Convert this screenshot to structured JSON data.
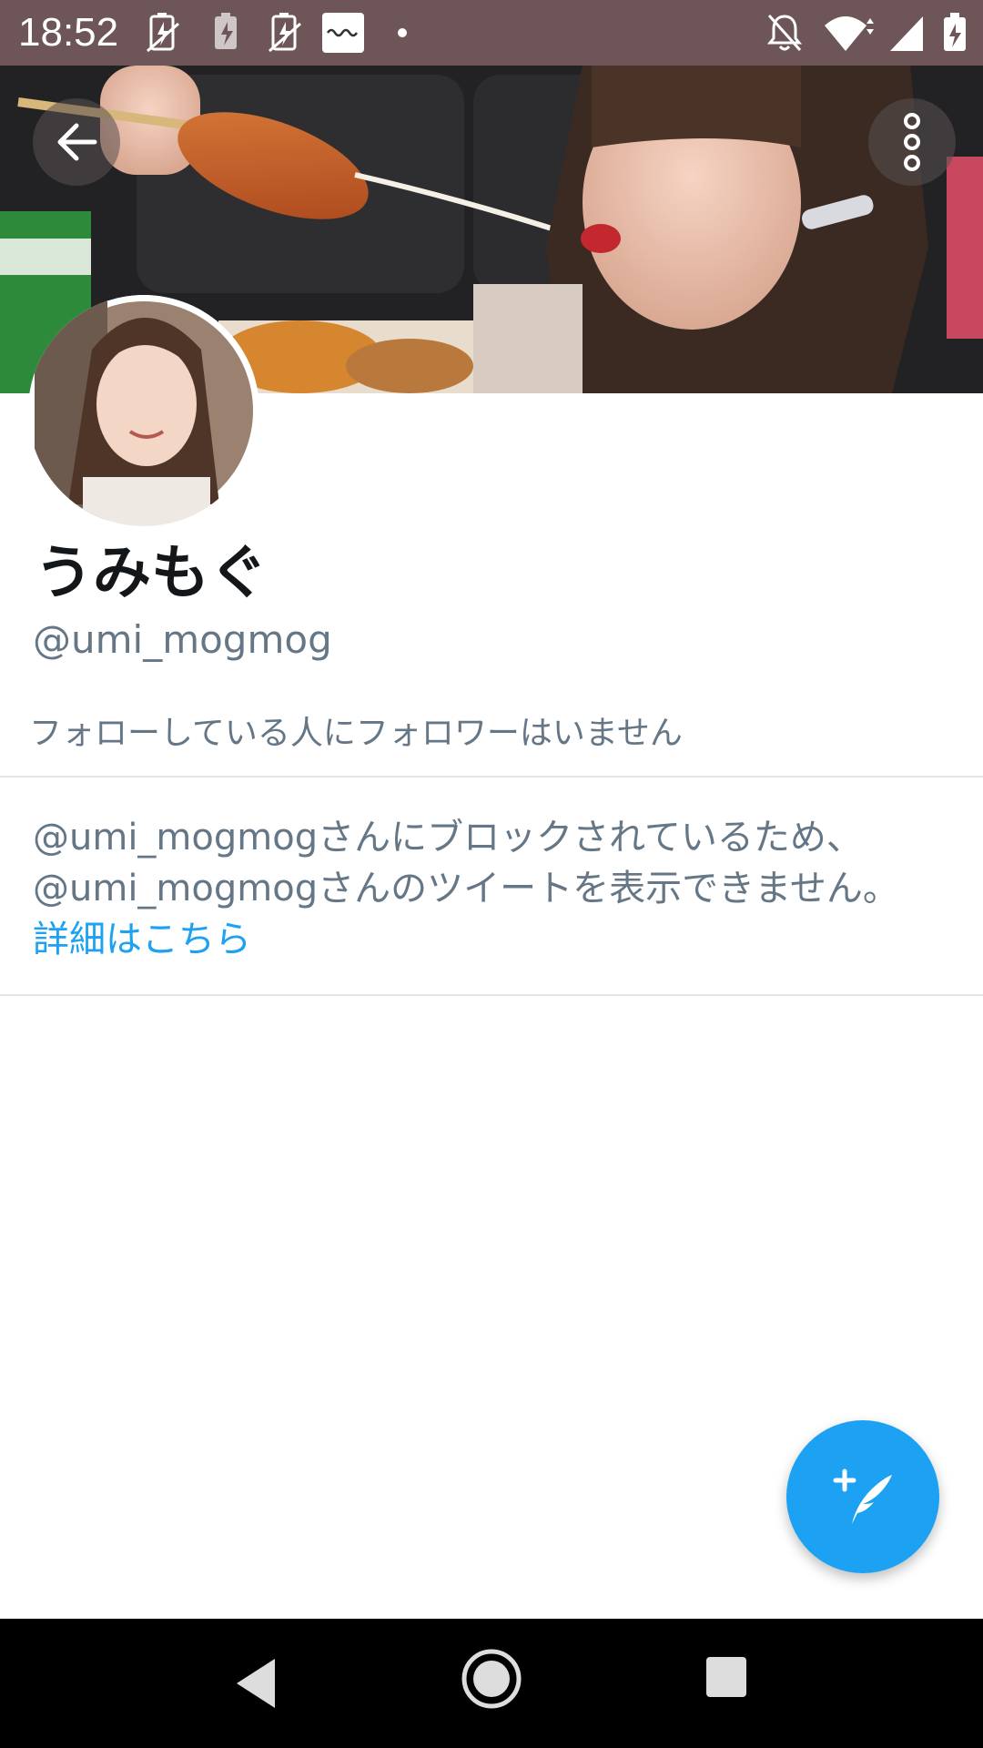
{
  "status_bar": {
    "time": "18:52",
    "left_icons": [
      "battery-alert-icon",
      "battery-charging-icon",
      "battery-alert-icon",
      "app-notification-icon",
      "dot-icon"
    ],
    "right_icons": [
      "notifications-off-icon",
      "wifi-icon",
      "signal-icon",
      "battery-icon"
    ]
  },
  "profile": {
    "display_name": "うみもぐ",
    "handle": "@umi_mogmog",
    "followers_note": "フォローしている人にフォロワーはいません"
  },
  "block_notice": {
    "line1": "@umi_mogmogさんにブロックされているため、",
    "line2": "@umi_mogmogさんのツイートを表示できません。",
    "learn_more": "詳細はこちら"
  },
  "colors": {
    "status_bar": "#6d5558",
    "accent": "#1da1f2",
    "secondary_text": "#657786",
    "primary_text": "#14171a",
    "divider": "#e1e8ed",
    "nav_bar": "#000000"
  },
  "icons": {
    "back": "arrow-left-icon",
    "overflow": "more-vertical-icon",
    "compose": "compose-tweet-icon",
    "nav_back": "nav-back-icon",
    "nav_home": "nav-home-icon",
    "nav_recents": "nav-recents-icon"
  }
}
